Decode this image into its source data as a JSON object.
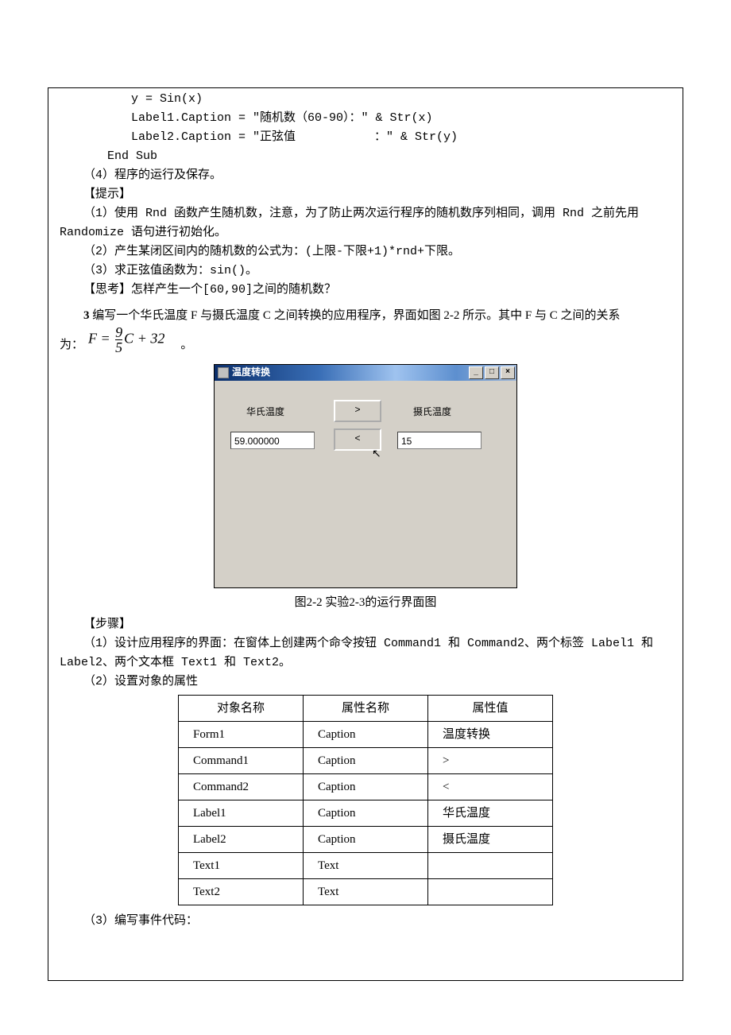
{
  "code": {
    "l1": "y = Sin(x)",
    "l2": "Label1.Caption = \"随机数（60-90）：\" & Str(x)",
    "l3": "Label2.Caption = \"正弦值           ：\" & Str(y)",
    "l4": "End Sub"
  },
  "p_step4": "（4）程序的运行及保存。",
  "hint_h": "【提示】",
  "hint1": "（1）使用 Rnd 函数产生随机数，注意，为了防止两次运行程序的随机数序列相同，调用 Rnd 之前先用 Randomize 语句进行初始化。",
  "hint2": "（2）产生某闭区间内的随机数的公式为：(上限-下限+1)*rnd+下限。",
  "hint3": "（3）求正弦值函数为：sin()。",
  "think": "【思考】怎样产生一个[60,90]之间的随机数？",
  "ex3_lead_num": "3",
  "ex3_lead": " 编写一个华氏温度 F 与摄氏温度 C 之间转换的应用程序，界面如图 2-2 所示。其中 F 与 C 之间的关系",
  "formula_pre": "为：",
  "formula_post": "。",
  "formula": {
    "lhs": "F",
    "eq": " = ",
    "frac_num": "9",
    "frac_den": "5",
    "c": "C",
    "tail": " + 32"
  },
  "fig": {
    "title": "温度转换",
    "label_f": "华氏温度",
    "label_c": "摄氏温度",
    "text_f": "59.000000",
    "text_c": "15",
    "btn_right": ">",
    "btn_left": "<",
    "sys_min": "_",
    "sys_max": "□",
    "sys_close": "×",
    "caption": "图2-2  实验2-3的运行界面图"
  },
  "steps_h": "【步骤】",
  "step1": "（1）设计应用程序的界面：在窗体上创建两个命令按钮 Command1 和 Command2、两个标签 Label1 和 Label2、两个文本框 Text1 和 Text2。",
  "step2": "（2）设置对象的属性",
  "table": {
    "h1": "对象名称",
    "h2": "属性名称",
    "h3": "属性值",
    "rows": [
      {
        "c1": "Form1",
        "c2": "Caption",
        "c3": "温度转换"
      },
      {
        "c1": "Command1",
        "c2": "Caption",
        "c3": ">"
      },
      {
        "c1": "Command2",
        "c2": "Caption",
        "c3": "<"
      },
      {
        "c1": "Label1",
        "c2": "Caption",
        "c3": "华氏温度"
      },
      {
        "c1": "Label2",
        "c2": "Caption",
        "c3": "摄氏温度"
      },
      {
        "c1": "Text1",
        "c2": "Text",
        "c3": ""
      },
      {
        "c1": "Text2",
        "c2": "Text",
        "c3": ""
      }
    ]
  },
  "step3": "（3）编写事件代码："
}
